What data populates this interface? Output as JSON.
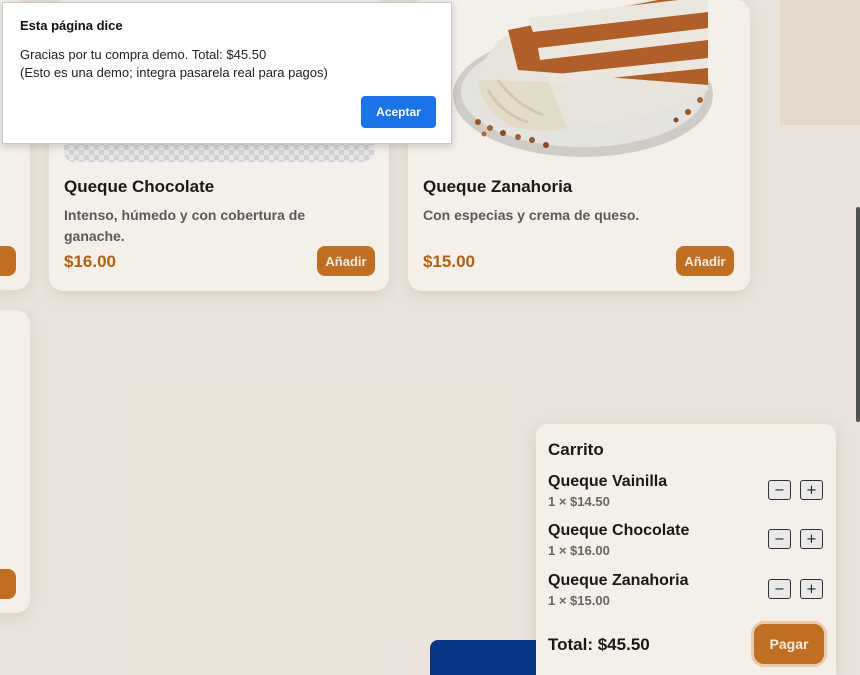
{
  "products": [
    {
      "title": "Queque Chocolate",
      "description": "Intenso, húmedo y con cobertura de ganache.",
      "price": "$16.00",
      "add_label": "Añadir"
    },
    {
      "title": "Queque Zanahoria",
      "description": "Con especias y crema de queso.",
      "price": "$15.00",
      "add_label": "Añadir"
    }
  ],
  "partial_add_label": "ir",
  "cart": {
    "title": "Carrito",
    "items": [
      {
        "name": "Queque Vainilla",
        "qty": "1 × $14.50",
        "minus": "−",
        "plus": "+"
      },
      {
        "name": "Queque Chocolate",
        "qty": "1 × $16.00",
        "minus": "−",
        "plus": "+"
      },
      {
        "name": "Queque Zanahoria",
        "qty": "1 × $15.00",
        "minus": "−",
        "plus": "+"
      }
    ],
    "total": "Total: $45.50",
    "pay_label": "Pagar"
  },
  "dialog": {
    "title": "Esta página dice",
    "message_line1": "Gracias por tu compra demo. Total: $45.50",
    "message_line2": "(Esto es una demo; integra pasarela real para pagos)",
    "accept_label": "Aceptar"
  },
  "colors": {
    "accent": "#c97524",
    "price": "#b9651c",
    "dialog_button": "#1a73e8"
  },
  "icons": [
    "cake-image",
    "minus-icon",
    "plus-icon"
  ]
}
